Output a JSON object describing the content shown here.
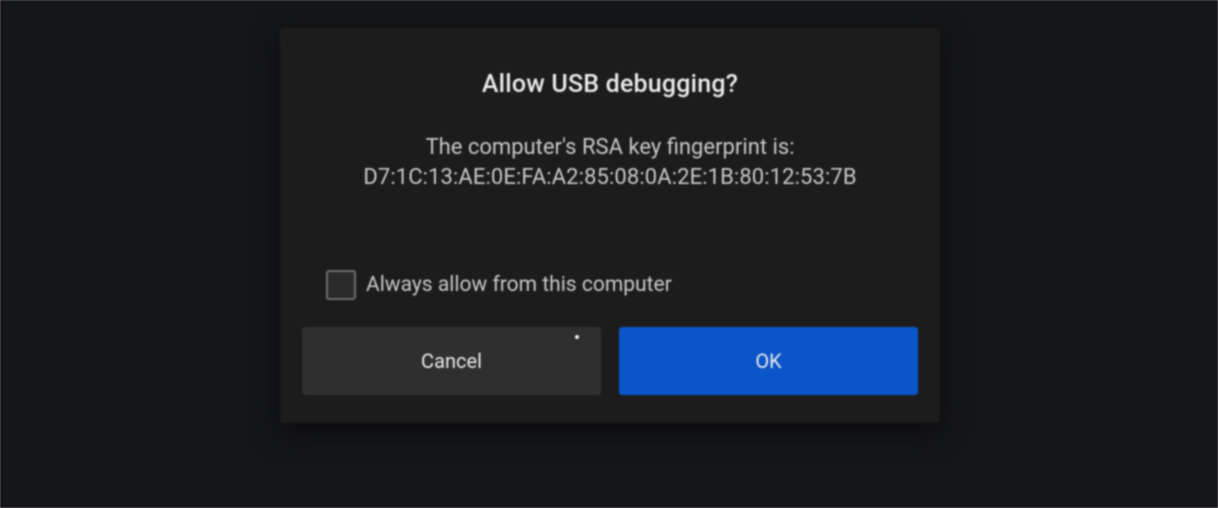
{
  "dialog": {
    "title": "Allow USB debugging?",
    "message": "The computer's RSA key fingerprint is:",
    "fingerprint": "D7:1C:13:AE:0E:FA:A2:85:08:0A:2E:1B:80:12:53:7B",
    "checkbox_label": "Always allow from this computer",
    "checkbox_checked": false,
    "buttons": {
      "cancel": "Cancel",
      "ok": "OK"
    }
  }
}
